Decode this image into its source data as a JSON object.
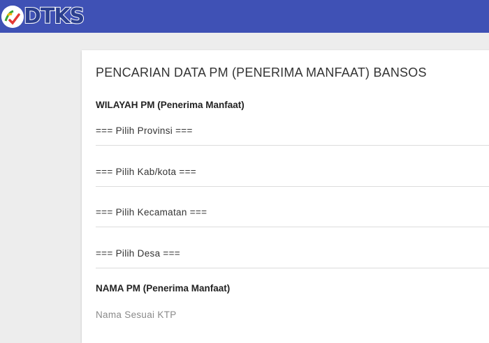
{
  "header": {
    "logo_text": "DTKS",
    "brand_color": "#3f51b5"
  },
  "form": {
    "title": "PENCARIAN DATA PM (PENERIMA MANFAAT) BANSOS",
    "wilayah_label": "WILAYAH PM (Penerima Manfaat)",
    "provinsi": "=== Pilih Provinsi ===",
    "kabkota": "=== Pilih Kab/kota ===",
    "kecamatan": "=== Pilih Kecamatan ===",
    "desa": "=== Pilih Desa ===",
    "nama_label": "NAMA PM (Penerima Manfaat)",
    "nama_placeholder": "Nama Sesuai KTP",
    "nama_value": ""
  }
}
